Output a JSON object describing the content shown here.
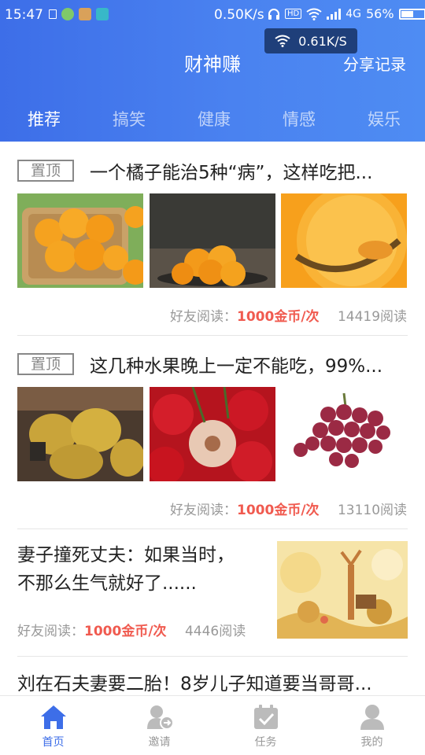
{
  "status_bar": {
    "time": "15:47",
    "speed": "0.50K/s",
    "network_badge": "HD",
    "network_type": "4G",
    "battery": "56%",
    "battery_level": 0.56
  },
  "net_toast": {
    "speed": "0.61K/S"
  },
  "app": {
    "title": "财神赚",
    "share_label": "分享记录"
  },
  "tabs": [
    {
      "label": "推荐",
      "active": true
    },
    {
      "label": "搞笑",
      "active": false
    },
    {
      "label": "健康",
      "active": false
    },
    {
      "label": "情感",
      "active": false
    },
    {
      "label": "娱乐",
      "active": false
    }
  ],
  "articles": [
    {
      "pin_label": "置顶",
      "title": "一个橘子能治5种“病”，这样吃把...",
      "friend_label": "好友阅读：",
      "coins": "1000金币/次",
      "reads": "14419阅读"
    },
    {
      "pin_label": "置顶",
      "title": "这几种水果晚上一定不能吃，99%...",
      "friend_label": "好友阅读：",
      "coins": "1000金币/次",
      "reads": "13110阅读"
    },
    {
      "title_line1": "妻子撞死丈夫：如果当时，",
      "title_line2": "不那么生气就好了......",
      "friend_label": "好友阅读：",
      "coins": "1000金币/次",
      "reads": "4446阅读"
    },
    {
      "title": "刘在石夫妻要二胎！8岁儿子知道要当哥哥..."
    }
  ],
  "nav": [
    {
      "label": "首页",
      "icon": "home-icon",
      "active": true
    },
    {
      "label": "邀请",
      "icon": "invite-user-icon",
      "active": false
    },
    {
      "label": "任务",
      "icon": "task-icon",
      "active": false
    },
    {
      "label": "我的",
      "icon": "profile-icon",
      "active": false
    }
  ],
  "colors": {
    "header": "#3d6ee8",
    "accent": "#f05a4f",
    "active_nav": "#3d6ee8"
  }
}
